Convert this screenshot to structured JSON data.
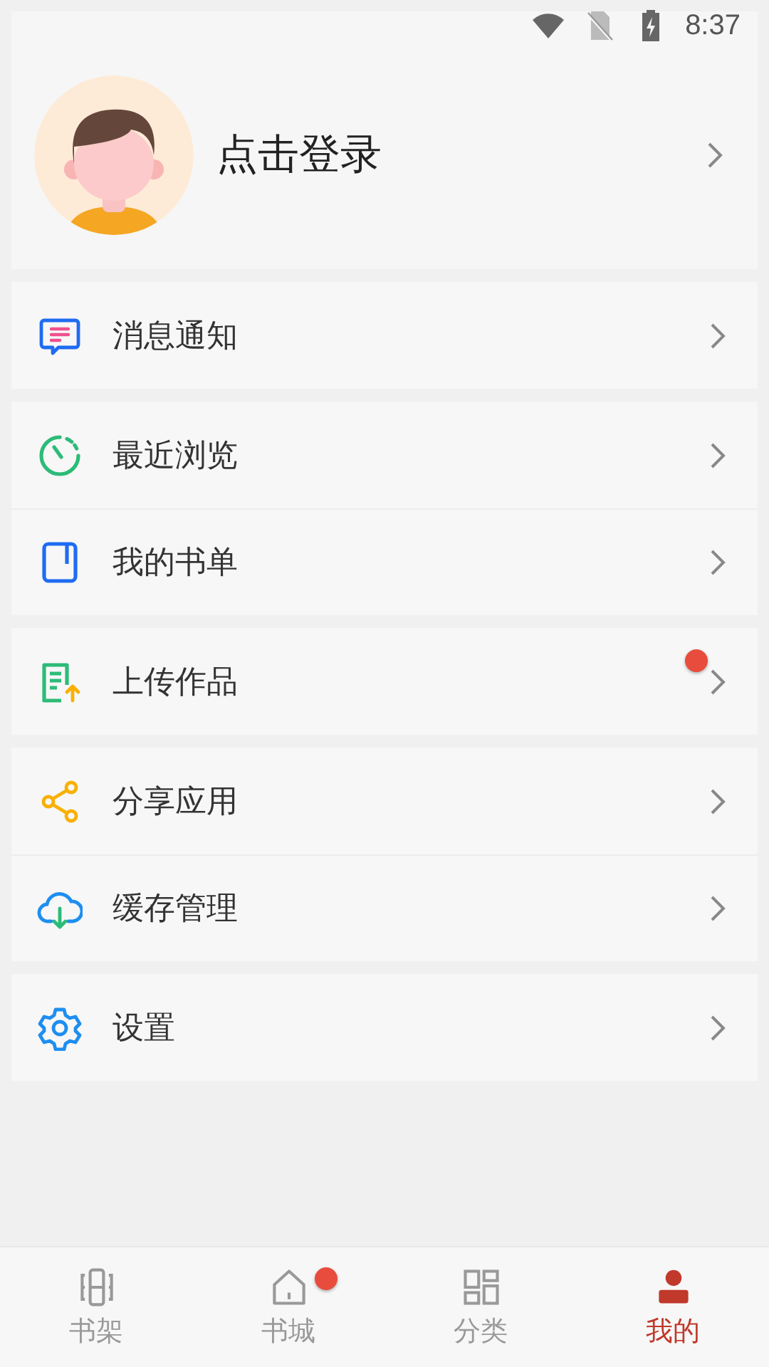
{
  "status_bar": {
    "time": "8:37"
  },
  "profile": {
    "login_text": "点击登录"
  },
  "groups": [
    {
      "items": [
        {
          "label": "消息通知",
          "badge": false
        }
      ]
    },
    {
      "items": [
        {
          "label": "最近浏览",
          "badge": false
        },
        {
          "label": "我的书单",
          "badge": false
        }
      ]
    },
    {
      "items": [
        {
          "label": "上传作品",
          "badge": true
        }
      ]
    },
    {
      "items": [
        {
          "label": "分享应用",
          "badge": false
        },
        {
          "label": "缓存管理",
          "badge": false
        }
      ]
    },
    {
      "items": [
        {
          "label": "设置",
          "badge": false
        }
      ]
    }
  ],
  "bottom_nav": [
    {
      "label": "书架",
      "selected": false,
      "badge": false
    },
    {
      "label": "书城",
      "selected": false,
      "badge": true
    },
    {
      "label": "分类",
      "selected": false,
      "badge": false
    },
    {
      "label": "我的",
      "selected": true,
      "badge": false
    }
  ]
}
